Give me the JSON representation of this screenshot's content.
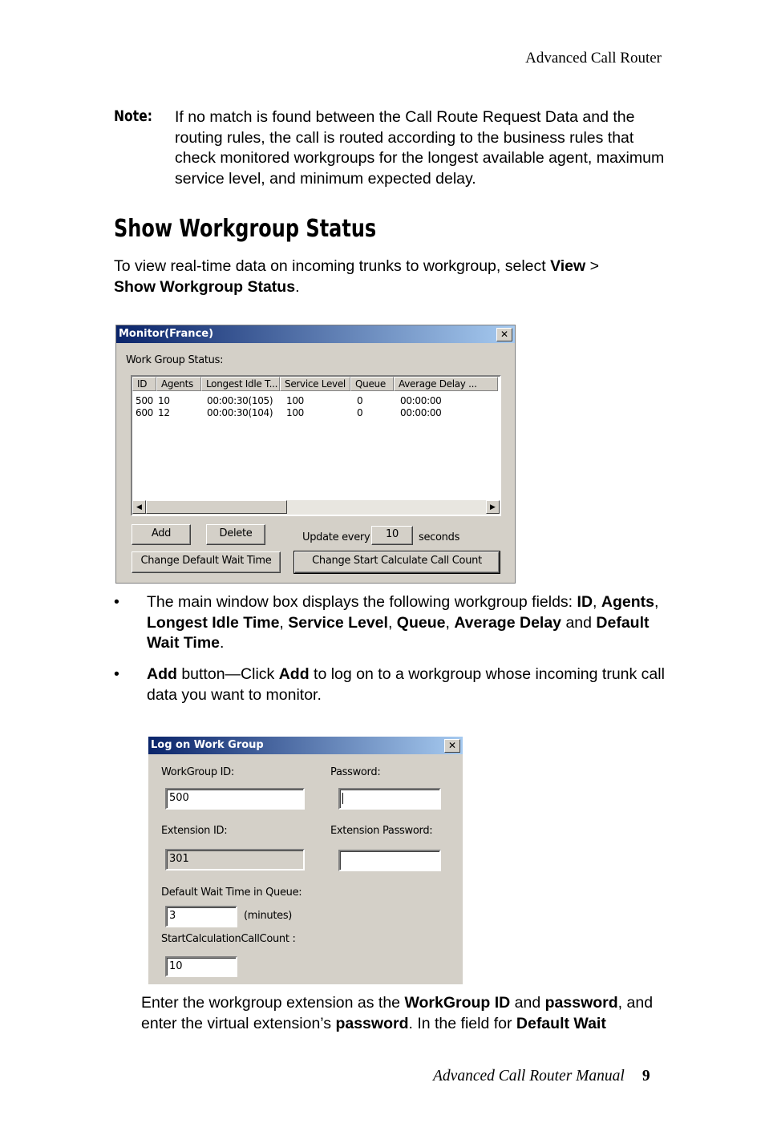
{
  "header": {
    "running_title": "Advanced Call Router"
  },
  "note": {
    "label": "Note:",
    "text": "If no match is found between the Call Route Request Data and the routing rules, the call is routed according to the business rules that check monitored workgroups for the longest available agent, maximum service level, and minimum expected delay."
  },
  "section": {
    "title": "Show Workgroup Status",
    "intro_prefix": "To view real-time data on incoming trunks to workgroup, select ",
    "intro_bold1": "View",
    "intro_sep": " > ",
    "intro_bold2": "Show Workgroup Status",
    "intro_end": "."
  },
  "monitor_window": {
    "title": "Monitor(France)",
    "close_glyph": "✕",
    "group_label": "Work Group Status:",
    "columns": [
      "ID",
      "Agents",
      "Longest Idle T...",
      "Service Level",
      "Queue",
      "Average Delay ..."
    ],
    "rows": [
      [
        "500",
        "10",
        "00:00:30(105)",
        "100",
        "0",
        "00:00:00"
      ],
      [
        "600",
        "12",
        "00:00:30(104)",
        "100",
        "0",
        "00:00:00"
      ]
    ],
    "scroll_left": "◀",
    "scroll_right": "▶",
    "add_label": "Add",
    "delete_label": "Delete",
    "update_prefix": "Update every",
    "update_value": "10",
    "update_suffix": "seconds",
    "change_wait_label": "Change Default Wait Time",
    "change_start_label": "Change Start Calculate Call Count"
  },
  "bullets": [
    {
      "marker": "•",
      "parts": [
        "The main window box displays the following workgroup fields: ",
        "ID",
        ", ",
        "Agents",
        ", ",
        "Longest Idle Time",
        ", ",
        "Service Level",
        ", ",
        "Queue",
        ", ",
        "Average Delay",
        " and ",
        "Default Wait Time",
        "."
      ]
    },
    {
      "marker": "•",
      "parts": [
        "Add",
        " button—Click ",
        "Add",
        " to log on to a workgroup whose incoming trunk call data you want to monitor."
      ]
    }
  ],
  "logon_window": {
    "title": "Log on Work Group",
    "close_glyph": "✕",
    "workgroup_id_label": "WorkGroup ID:",
    "workgroup_id_value": "500",
    "password_label": "Password:",
    "password_value": "",
    "extension_id_label": "Extension ID:",
    "extension_id_value": "301",
    "extension_password_label": "Extension Password:",
    "extension_password_value": "",
    "wait_label": "Default Wait Time in Queue:",
    "wait_value": "3",
    "wait_unit": "(minutes)",
    "start_count_label": "StartCalculationCallCount :",
    "start_count_value": "10"
  },
  "closing": {
    "parts": [
      "Enter the workgroup extension as the ",
      "WorkGroup ID",
      " and ",
      "password",
      ", and enter the virtual extension’s ",
      "password",
      ". In the field for ",
      "Default Wait"
    ]
  },
  "footer": {
    "manual_title": "Advanced Call Router Manual",
    "page_number": "9"
  }
}
